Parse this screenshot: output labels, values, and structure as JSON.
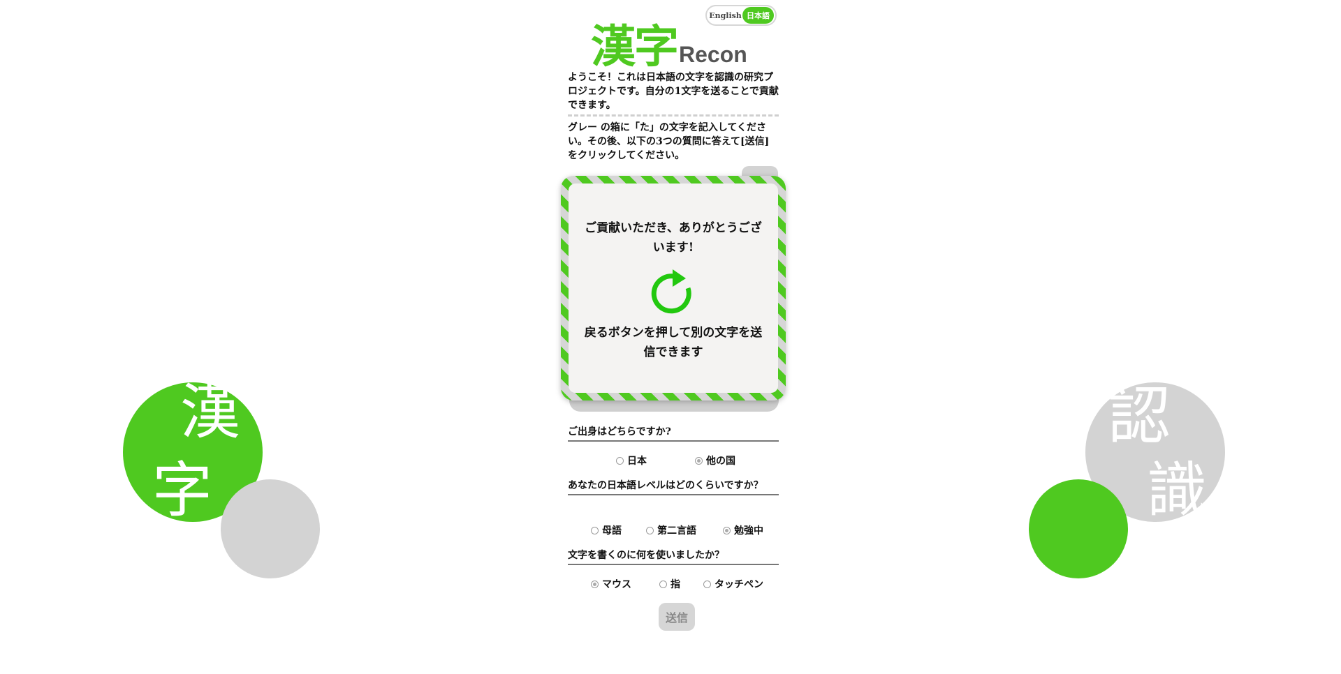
{
  "header": {
    "logo_kanji": "漢字",
    "logo_latin": "Recon",
    "lang_english": "English",
    "lang_japanese": "日本語"
  },
  "intro_text": "ようこそ！これは日本語の文字を認識の研究プロジェクトです。自分の1文字を送ることで貢献できます。",
  "instruction_text": "グレー の箱に「た」の文字を記入してください。その後、以下の3つの質問に答えて[送信]をクリックしてください。",
  "modal": {
    "thanks": "ご貢献いただき、ありがとうございます!",
    "back_hint": "戻るボタンを押して別の文字を送信できます",
    "icon": "refresh-icon"
  },
  "questions": [
    {
      "label": "ご出身はどちらですか?",
      "options": [
        "日本",
        "他の国"
      ],
      "selected": 1
    },
    {
      "label": "あなたの日本語レベルはどのくらいですか？",
      "options": [
        "母語",
        "第二言語",
        "勉強中"
      ],
      "selected": 2
    },
    {
      "label": "文字を書くのに何を使いましたか？",
      "options": [
        "マウス",
        "指",
        "タッチペン"
      ],
      "selected": 0
    }
  ],
  "submit_label": "送信",
  "decorations": {
    "left_chars": [
      "漢",
      "字"
    ],
    "right_chars": [
      "認",
      "識"
    ]
  },
  "colors": {
    "accent_green": "#4fc920",
    "neutral_gray": "#d3d3d3"
  }
}
